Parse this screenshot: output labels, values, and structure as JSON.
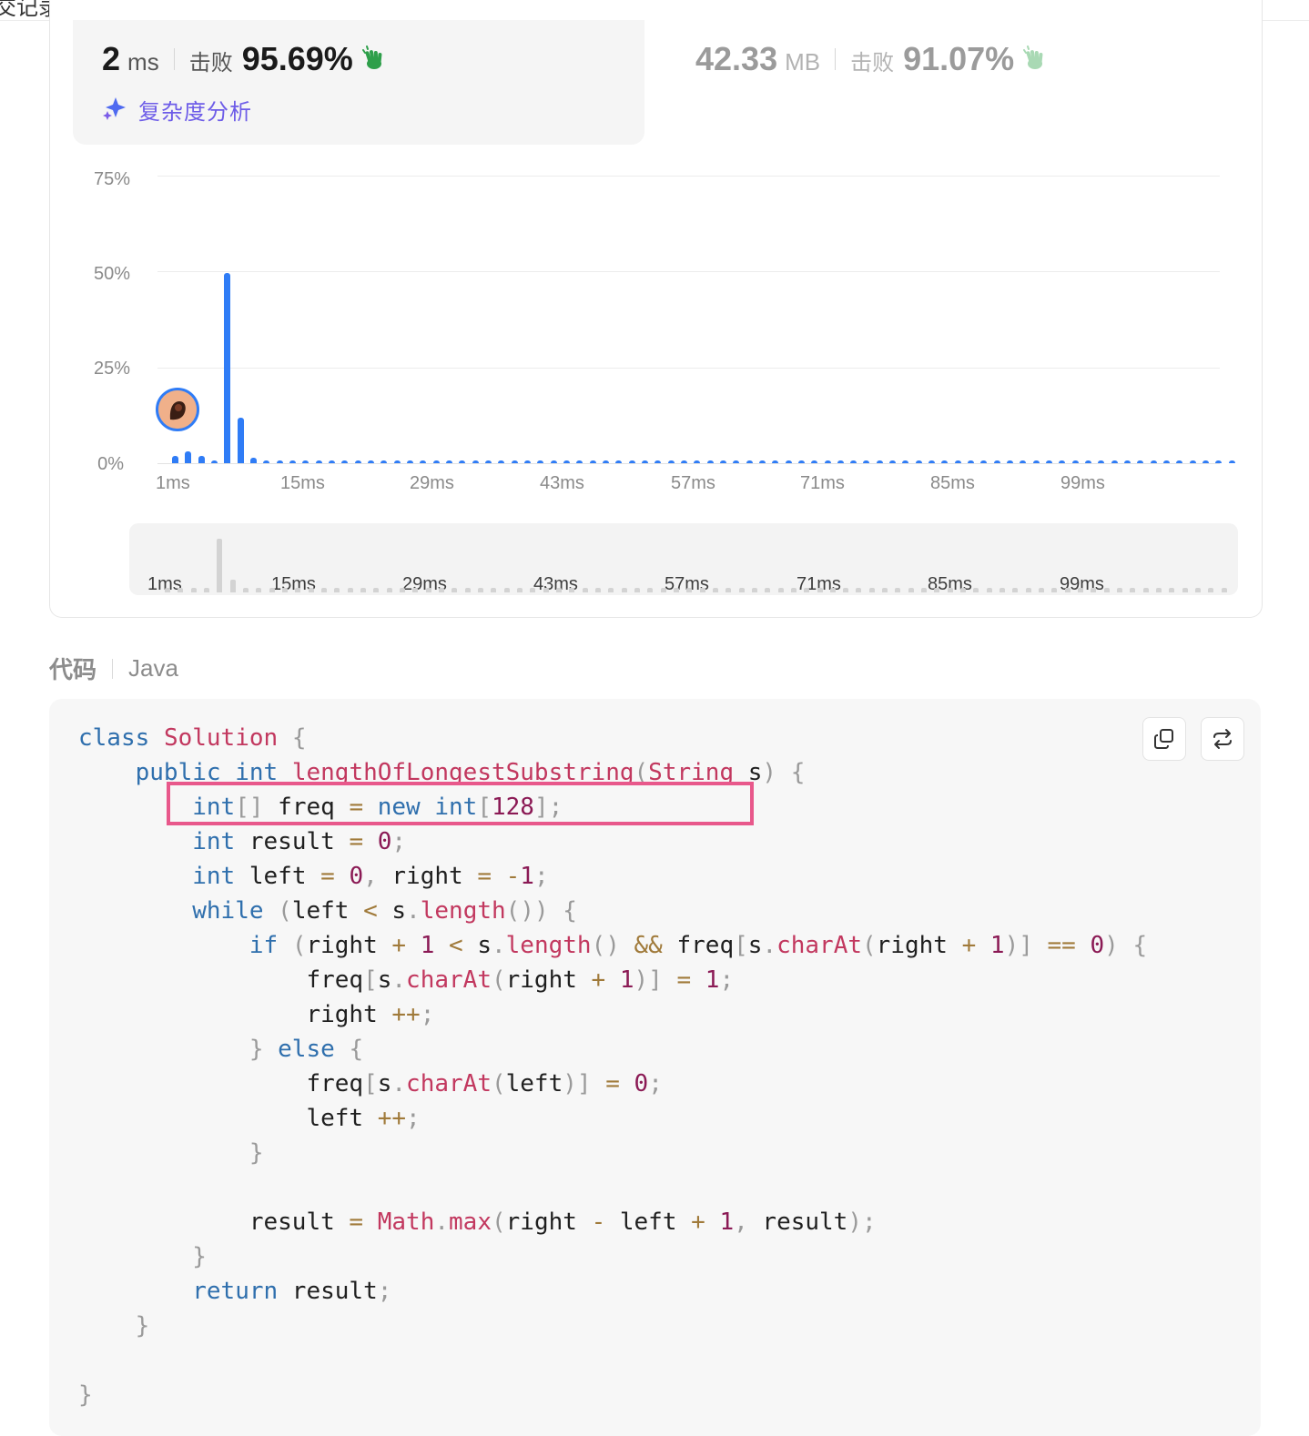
{
  "top_cutoff_text": "交记录",
  "runtime": {
    "value": "2",
    "unit": "ms",
    "beat_label": "击败",
    "beat_pct": "95.69%"
  },
  "memory": {
    "value": "42.33",
    "unit": "MB",
    "beat_label": "击败",
    "beat_pct": "91.07%"
  },
  "complexity_link": "复杂度分析",
  "colors": {
    "bar": "#2f7cf6",
    "accent_purple": "#6d5ce8",
    "highlight": "#e8588b"
  },
  "chart_data": {
    "type": "bar",
    "y_ticks": [
      "75%",
      "50%",
      "25%",
      "0%"
    ],
    "ylim": [
      0,
      75
    ],
    "x_tick_labels": [
      "1ms",
      "15ms",
      "29ms",
      "43ms",
      "57ms",
      "71ms",
      "85ms",
      "99ms"
    ],
    "x_start_ms": 1,
    "values": [
      1.8,
      3.2,
      1.8,
      0.6,
      49.5,
      11.8,
      1.4,
      0.7,
      0.6,
      0.6,
      0.6,
      0.6,
      0.6,
      0.6,
      0.6,
      0.6,
      0.6,
      0.6,
      0.6,
      0.6,
      0.6,
      0.6,
      0.6,
      0.6,
      0.6,
      0.6,
      0.6,
      0.6,
      0.6,
      0.6,
      0.6,
      0.6,
      0.6,
      0.6,
      0.6,
      0.6,
      0.6,
      0.6,
      0.6,
      0.6,
      0.6,
      0.6,
      0.6,
      0.6,
      0.6,
      0.6,
      0.6,
      0.6,
      0.6,
      0.6,
      0.6,
      0.6,
      0.6,
      0.6,
      0.6,
      0.6,
      0.6,
      0.6,
      0.6,
      0.6,
      0.6,
      0.6,
      0.6,
      0.6,
      0.6,
      0.6,
      0.6,
      0.6,
      0.6,
      0.6,
      0.6,
      0.6,
      0.6,
      0.6,
      0.6,
      0.6,
      0.6,
      0.6,
      0.6,
      0.6,
      0.6,
      0.6
    ],
    "user_marker_ms": 2
  },
  "code_section": {
    "title": "代码",
    "language": "Java"
  },
  "code_lines": [
    "class Solution {",
    "    public int lengthOfLongestSubstring(String s) {",
    "        int[] freq = new int[128];",
    "        int result = 0;",
    "        int left = 0, right = -1;",
    "        while (left < s.length()) {",
    "            if (right + 1 < s.length() && freq[s.charAt(right + 1)] == 0) {",
    "                freq[s.charAt(right + 1)] = 1;",
    "                right ++;",
    "            } else {",
    "                freq[s.charAt(left)] = 0;",
    "                left ++;",
    "            }",
    "",
    "            result = Math.max(right - left + 1, result);",
    "        }",
    "        return result;",
    "    }",
    "",
    "}"
  ]
}
